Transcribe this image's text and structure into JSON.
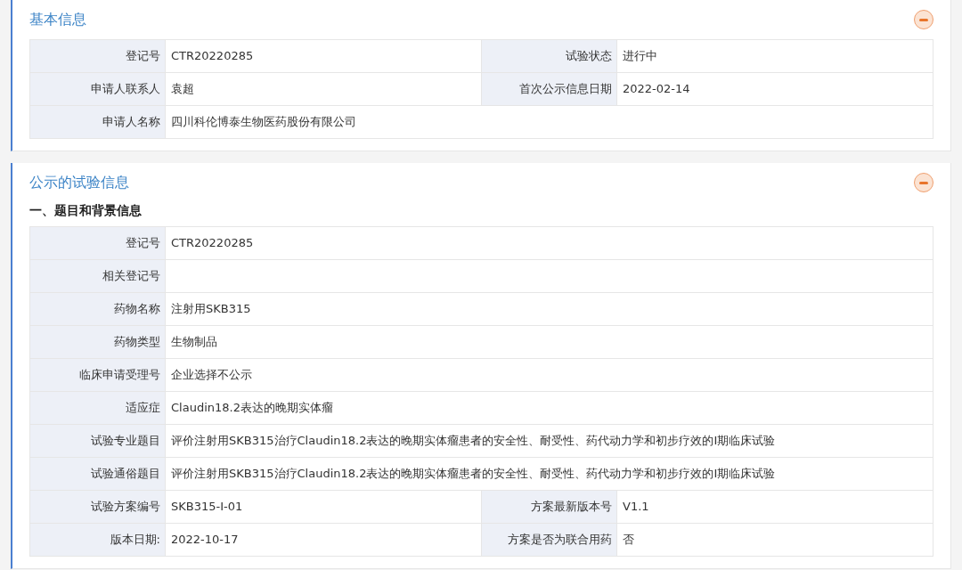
{
  "sections": [
    {
      "title": "基本信息",
      "expanded": true,
      "rows": [
        [
          {
            "label": "登记号",
            "value": "CTR20220285"
          },
          {
            "label": "试验状态",
            "value": "进行中"
          }
        ],
        [
          {
            "label": "申请人联系人",
            "value": "袁超"
          },
          {
            "label": "首次公示信息日期",
            "value": "2022-02-14"
          }
        ],
        [
          {
            "label": "申请人名称",
            "value": "四川科伦博泰生物医药股份有限公司"
          }
        ]
      ]
    },
    {
      "title": "公示的试验信息",
      "expanded": true,
      "subheading": "一、题目和背景信息",
      "rows": [
        [
          {
            "label": "登记号",
            "value": "CTR20220285"
          }
        ],
        [
          {
            "label": "相关登记号"
          }
        ],
        [
          {
            "label": "药物名称",
            "value": "注射用SKB315"
          }
        ],
        [
          {
            "label": "药物类型",
            "value": "生物制品"
          }
        ],
        [
          {
            "label": "临床申请受理号",
            "value": "企业选择不公示"
          }
        ],
        [
          {
            "label": "适应症",
            "value": "Claudin18.2表达的晚期实体瘤"
          }
        ],
        [
          {
            "label": "试验专业题目",
            "value": "评价注射用SKB315治疗Claudin18.2表达的晚期实体瘤患者的安全性、耐受性、药代动力学和初步疗效的I期临床试验"
          }
        ],
        [
          {
            "label": "试验通俗题目",
            "value": "评价注射用SKB315治疗Claudin18.2表达的晚期实体瘤患者的安全性、耐受性、药代动力学和初步疗效的I期临床试验"
          }
        ],
        [
          {
            "label": "试验方案编号",
            "value": "SKB315-I-01"
          },
          {
            "label": "方案最新版本号",
            "value": "V1.1"
          }
        ],
        [
          {
            "label": "版本日期:",
            "value": "2022-10-17"
          },
          {
            "label": "方案是否为联合用药",
            "value": "否"
          }
        ]
      ]
    }
  ]
}
